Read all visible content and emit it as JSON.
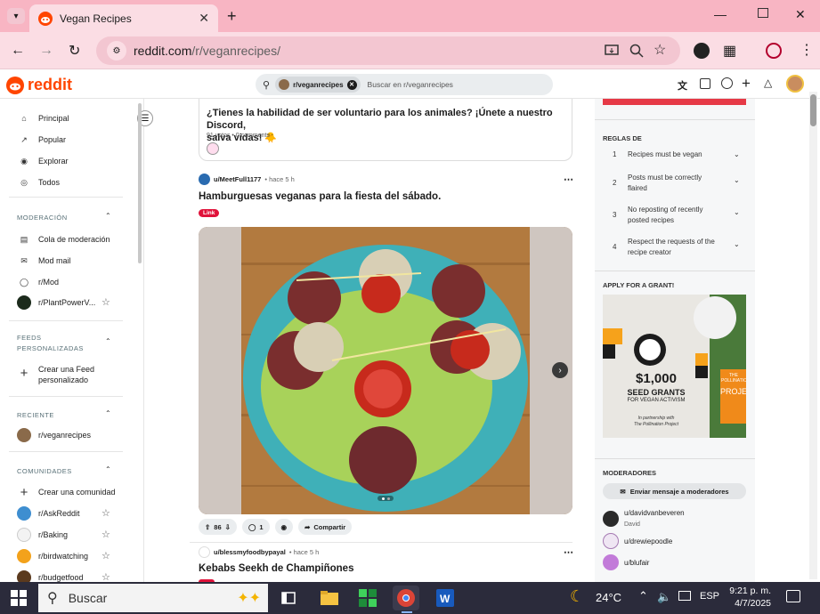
{
  "browser": {
    "tab_title": "Vegan Recipes",
    "url_host": "reddit.com",
    "url_path": "/r/veganrecipes/"
  },
  "header": {
    "logo_text": "reddit",
    "search_chip": "r/veganrecipes",
    "search_placeholder": "Buscar en r/veganrecipes"
  },
  "sidebar": {
    "main": [
      "Principal",
      "Popular",
      "Explorar",
      "Todos"
    ],
    "moderation_title": "MODERACIÓN",
    "moderation": [
      "Cola de moderación",
      "Mod mail",
      "r/Mod",
      "r/PlantPowerV..."
    ],
    "feeds_title": [
      "FEEDS",
      "PERSONALIZADAS"
    ],
    "create_feed": [
      "Crear una Feed",
      "personalizado"
    ],
    "recent_title": "RECIENTE",
    "recent": [
      "r/veganrecipes"
    ],
    "communities_title": "COMUNIDADES",
    "create_community": "Crear una comunidad",
    "communities": [
      "r/AskReddit",
      "r/Baking",
      "r/birdwatching",
      "r/budgetfood"
    ]
  },
  "posts": [
    {
      "title_line1": "¿Tienes la habilidad de ser voluntario para los animales? ¡Únete a nuestro Discord,",
      "title_line2": "salva vidas! 🐥",
      "meta": "91 votos • 0 comments"
    },
    {
      "author": "u/MeetFull1177",
      "time": "• hace 5 h",
      "title": "Hamburguesas veganas para la fiesta del sábado.",
      "flair": "Link",
      "votes": "86",
      "comments": "1",
      "share": "Compartir"
    },
    {
      "author": "u/blessmyfoodbypayal",
      "time": "• hace 5 h",
      "title": "Kebabs Seekh de Champiñones"
    }
  ],
  "rules": {
    "title": "REGLAS DE",
    "items": [
      {
        "n": "1",
        "l1": "Recipes must be vegan",
        "l2": ""
      },
      {
        "n": "2",
        "l1": "Posts must be correctly",
        "l2": "flaired"
      },
      {
        "n": "3",
        "l1": "No reposting of recently",
        "l2": "posted recipes"
      },
      {
        "n": "4",
        "l1": "Respect the requests of the",
        "l2": "recipe creator"
      }
    ]
  },
  "grant": {
    "title": "APPLY FOR A GRANT!",
    "amount": "$1,000",
    "line1": "SEED GRANTS",
    "line2": "FOR VEGAN ACTIVISM",
    "partner1": "In partnership with",
    "partner2": "The Pollination Project",
    "side1": "THE POLLINATION",
    "side2": "PROJECT"
  },
  "moderators": {
    "title": "MODERADORES",
    "message_button": "Enviar mensaje a moderadores",
    "list": [
      {
        "name": "u/davidvanbeveren",
        "sub": "David"
      },
      {
        "name": "u/drewiepoodle",
        "sub": ""
      },
      {
        "name": "u/blufair",
        "sub": ""
      }
    ]
  },
  "taskbar": {
    "search_placeholder": "Buscar",
    "temperature": "24°C",
    "lang": "ESP",
    "time": "9:21 p. m.",
    "date": "4/7/2025"
  },
  "colors": {
    "reddit_orange": "#ff4500",
    "tab_strip": "#f8b5c3",
    "flair_red": "#e0123a"
  }
}
